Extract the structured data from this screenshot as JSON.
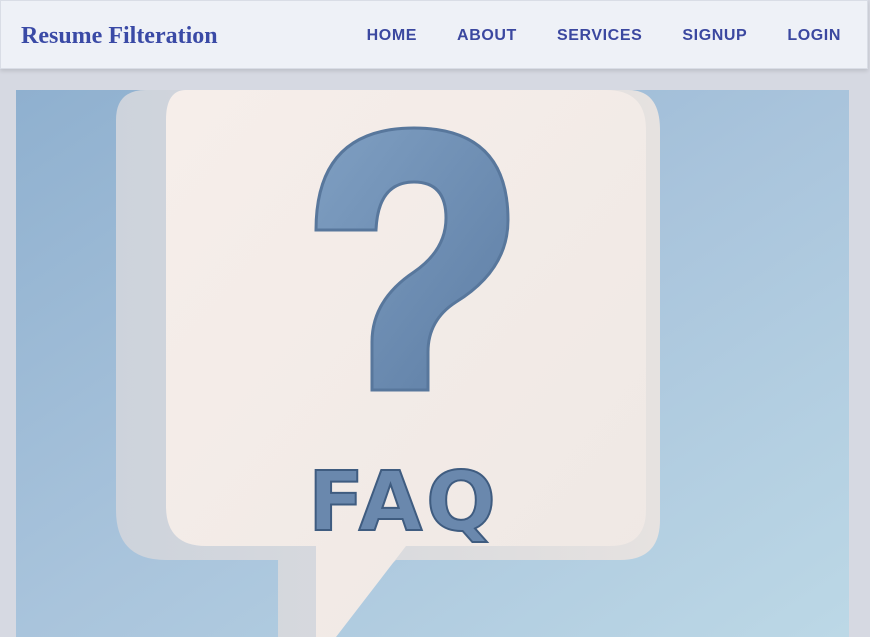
{
  "header": {
    "brand": "Resume Filteration",
    "nav": [
      {
        "label": "HOME"
      },
      {
        "label": "ABOUT"
      },
      {
        "label": "SERVICES"
      },
      {
        "label": "SIGNUP"
      },
      {
        "label": "LOGIN"
      }
    ]
  },
  "hero": {
    "image_text": "FAQ",
    "image_symbol": "?"
  },
  "colors": {
    "accent": "#3a4aa6",
    "navbar_bg": "#eef1f7",
    "page_bg": "#d6d9e2",
    "bubble": "#f2ece8",
    "sky": "#a9c4dc"
  }
}
